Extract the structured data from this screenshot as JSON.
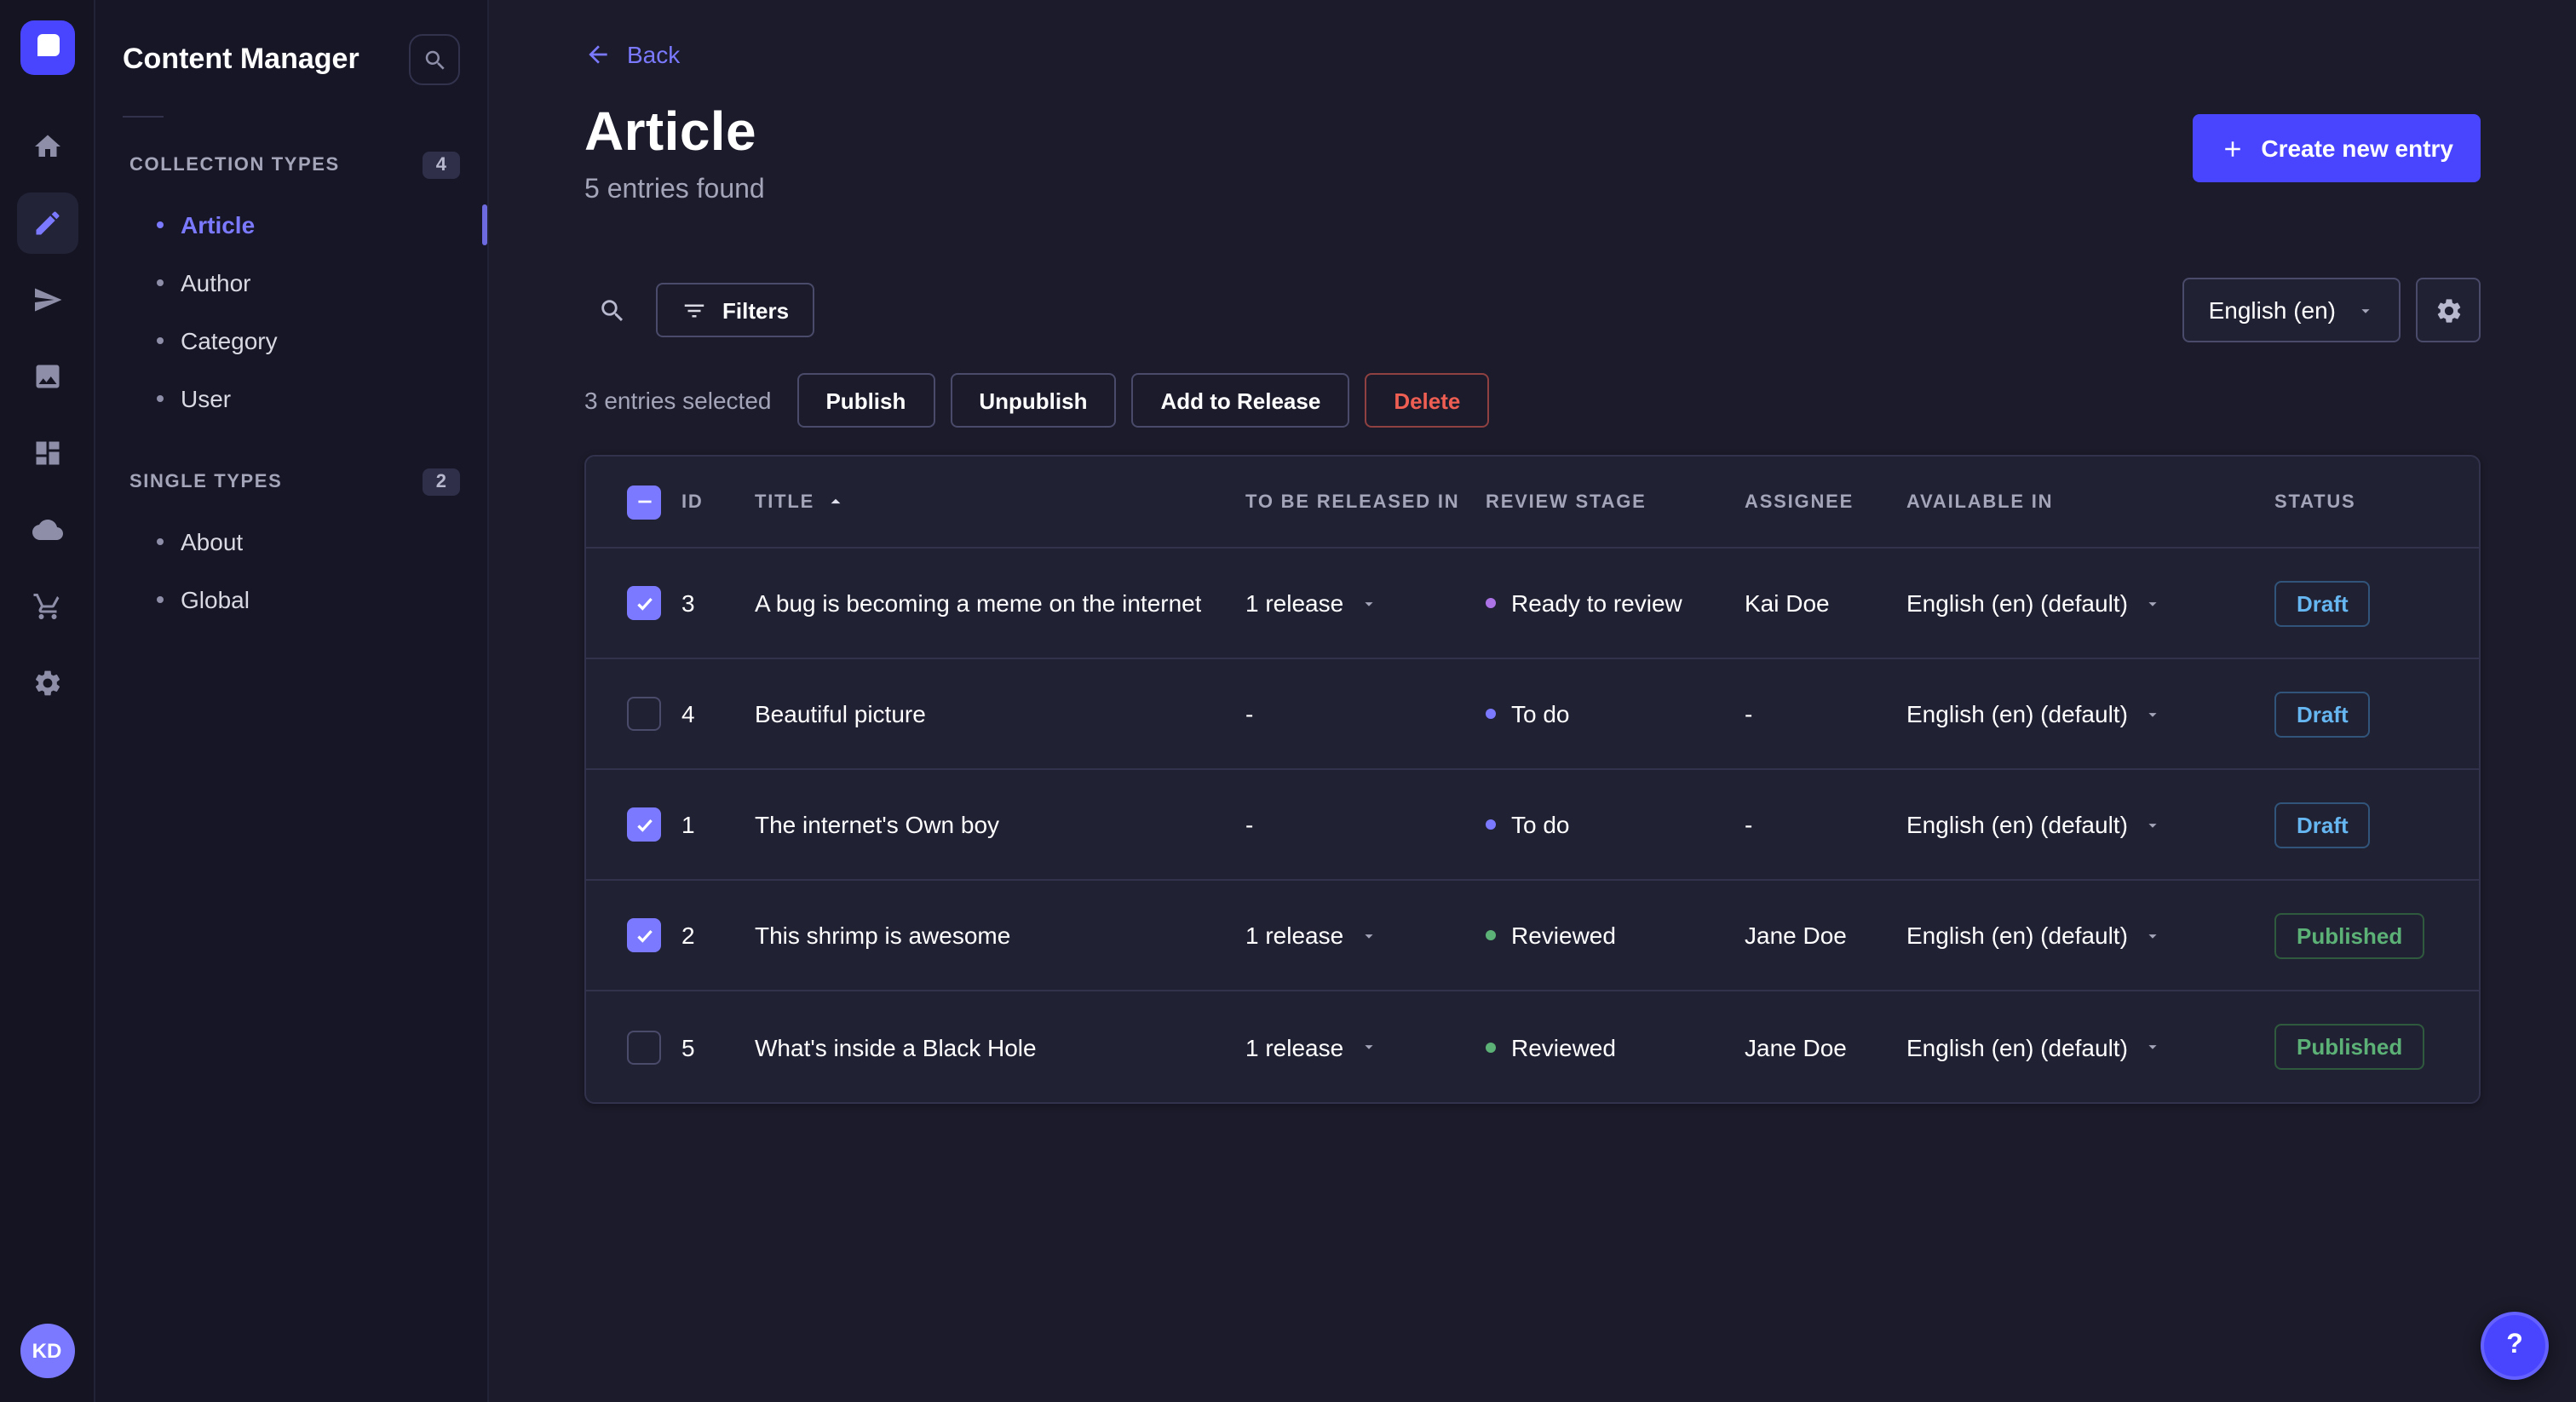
{
  "colors": {
    "primary": "#4945ff",
    "primary_light": "#7b79ff",
    "success": "#5cb176",
    "danger": "#ee5e52",
    "info": "#66b7f1"
  },
  "rail": {
    "icons": [
      {
        "name": "home"
      },
      {
        "name": "content-manager",
        "active": true
      },
      {
        "name": "releases"
      },
      {
        "name": "media-library"
      },
      {
        "name": "content-type-builder"
      },
      {
        "name": "cloud"
      },
      {
        "name": "marketplace"
      },
      {
        "name": "settings"
      }
    ],
    "avatar_initials": "KD"
  },
  "sidebar": {
    "title": "Content Manager",
    "sections": [
      {
        "label": "COLLECTION TYPES",
        "badge": "4",
        "items": [
          {
            "label": "Article",
            "active": true
          },
          {
            "label": "Author"
          },
          {
            "label": "Category"
          },
          {
            "label": "User"
          }
        ]
      },
      {
        "label": "SINGLE TYPES",
        "badge": "2",
        "items": [
          {
            "label": "About"
          },
          {
            "label": "Global"
          }
        ]
      }
    ]
  },
  "header": {
    "back_label": "Back",
    "title": "Article",
    "subtitle": "5 entries found",
    "create_label": "Create new entry"
  },
  "toolbar": {
    "filters_label": "Filters",
    "locale_value": "English (en)"
  },
  "selection": {
    "count_label": "3 entries selected",
    "publish_label": "Publish",
    "unpublish_label": "Unpublish",
    "add_release_label": "Add to Release",
    "delete_label": "Delete"
  },
  "table": {
    "columns": [
      "ID",
      "TITLE",
      "TO BE RELEASED IN",
      "REVIEW STAGE",
      "ASSIGNEE",
      "AVAILABLE IN",
      "STATUS"
    ],
    "sorted_column": "TITLE",
    "sort_direction": "asc",
    "status_styles": {
      "Draft": {
        "text": "#66b7f1",
        "border": "#31557a",
        "bg": "#212134"
      },
      "Published": {
        "text": "#5cb176",
        "border": "#2f5a3d",
        "bg": "#212134"
      }
    },
    "rows": [
      {
        "checked": true,
        "id": "3",
        "title": "A bug is becoming a meme on the internet",
        "release": "1 release",
        "stage": "Ready to review",
        "stage_color": "#ac73e6",
        "assignee": "Kai Doe",
        "available": "English (en) (default)",
        "status": "Draft"
      },
      {
        "checked": false,
        "id": "4",
        "title": "Beautiful picture",
        "release": "-",
        "stage": "To do",
        "stage_color": "#7b79ff",
        "assignee": "-",
        "available": "English (en) (default)",
        "status": "Draft"
      },
      {
        "checked": true,
        "id": "1",
        "title": "The internet's Own boy",
        "release": "-",
        "stage": "To do",
        "stage_color": "#7b79ff",
        "assignee": "-",
        "available": "English (en) (default)",
        "status": "Draft"
      },
      {
        "checked": true,
        "id": "2",
        "title": "This shrimp is awesome",
        "release": "1 release",
        "stage": "Reviewed",
        "stage_color": "#5cb176",
        "assignee": "Jane Doe",
        "available": "English (en) (default)",
        "status": "Published"
      },
      {
        "checked": false,
        "id": "5",
        "title": "What's inside a Black Hole",
        "release": "1 release",
        "stage": "Reviewed",
        "stage_color": "#5cb176",
        "assignee": "Jane Doe",
        "available": "English (en) (default)",
        "status": "Published"
      }
    ]
  },
  "help": {
    "label": "?"
  }
}
